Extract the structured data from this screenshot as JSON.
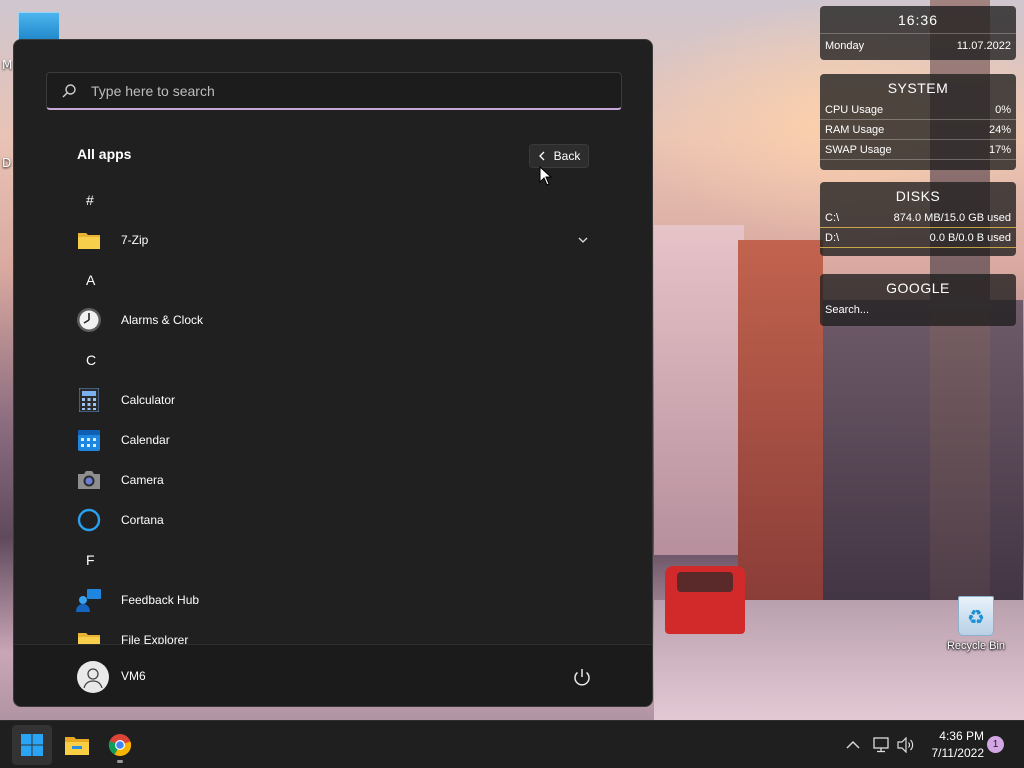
{
  "desktop": {
    "edge_labels": [
      "M",
      "D"
    ],
    "recycle_bin": {
      "label": "Recycle Bin"
    }
  },
  "widgets": {
    "clock": {
      "time": "16:36",
      "day": "Monday",
      "date": "11.07.2022"
    },
    "system": {
      "title": "SYSTEM",
      "rows": [
        {
          "label": "CPU Usage",
          "value": "0%"
        },
        {
          "label": "RAM Usage",
          "value": "24%"
        },
        {
          "label": "SWAP Usage",
          "value": "17%"
        }
      ]
    },
    "disks": {
      "title": "DISKS",
      "rows": [
        {
          "label": "C:\\",
          "value": "874.0 MB/15.0 GB used"
        },
        {
          "label": "D:\\",
          "value": "0.0 B/0.0 B used"
        }
      ]
    },
    "google": {
      "title": "GOOGLE",
      "search_placeholder": "Search..."
    }
  },
  "start_menu": {
    "search_placeholder": "Type here to search",
    "heading": "All apps",
    "back_label": "Back",
    "list": [
      {
        "kind": "letter",
        "text": "#"
      },
      {
        "kind": "app",
        "text": "7-Zip",
        "icon": "folder-icon",
        "expandable": true
      },
      {
        "kind": "letter",
        "text": "A"
      },
      {
        "kind": "app",
        "text": "Alarms & Clock",
        "icon": "clock-icon"
      },
      {
        "kind": "letter",
        "text": "C"
      },
      {
        "kind": "app",
        "text": "Calculator",
        "icon": "calculator-icon"
      },
      {
        "kind": "app",
        "text": "Calendar",
        "icon": "calendar-icon"
      },
      {
        "kind": "app",
        "text": "Camera",
        "icon": "camera-icon"
      },
      {
        "kind": "app",
        "text": "Cortana",
        "icon": "cortana-icon"
      },
      {
        "kind": "letter",
        "text": "F"
      },
      {
        "kind": "app",
        "text": "Feedback Hub",
        "icon": "feedback-hub-icon"
      },
      {
        "kind": "app",
        "text": "File Explorer",
        "icon": "folder-icon"
      }
    ],
    "user_name": "VM6"
  },
  "taskbar": {
    "clock_time": "4:36 PM",
    "clock_date": "7/11/2022",
    "notification_count": "1",
    "pinned": [
      "windows-start-icon",
      "file-explorer-icon",
      "chrome-icon"
    ],
    "tray_icons": [
      "chevron-up-icon",
      "network-icon",
      "volume-icon"
    ]
  },
  "colors": {
    "start_bg": "#202020",
    "search_accent": "#c7a6d8",
    "badge": "#d3a6e4",
    "windows_blue": "#1f9cf0"
  }
}
